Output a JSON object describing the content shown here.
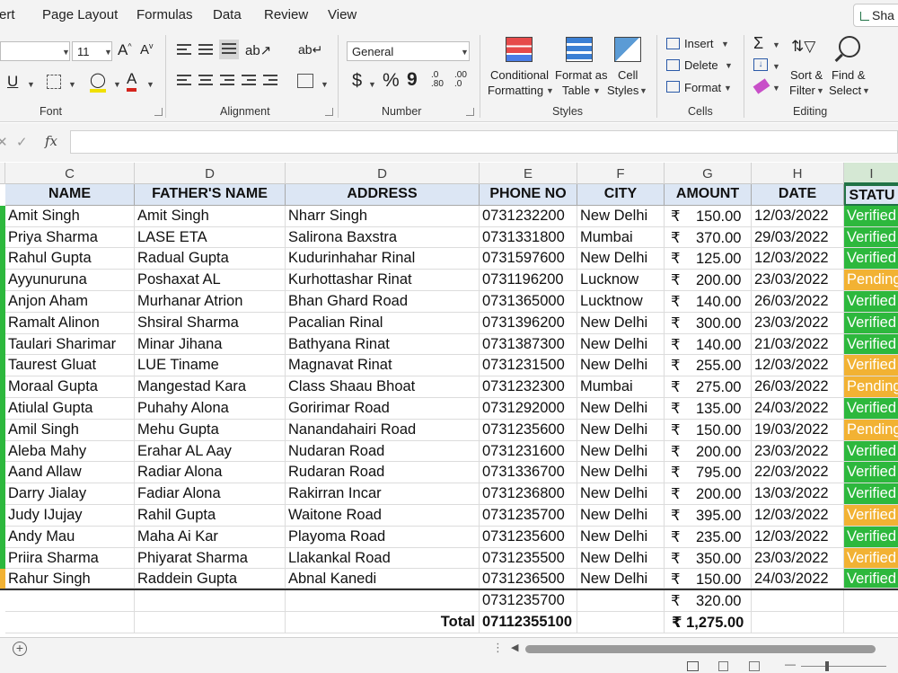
{
  "menu": [
    "ert",
    "Page Layout",
    "Formulas",
    "Data",
    "Review",
    "View"
  ],
  "share_label": "Sha",
  "ribbon": {
    "font_size": "11",
    "number_format": "General",
    "groups": {
      "font": "Font",
      "alignment": "Alignment",
      "number": "Number",
      "styles": "Styles",
      "cells": "Cells",
      "editing": "Editing"
    },
    "buttons": {
      "conditional_formatting_1": "Conditional",
      "conditional_formatting_2": "Formatting",
      "format_as_table_1": "Format as",
      "format_as_table_2": "Table",
      "cell_styles_1": "Cell",
      "cell_styles_2": "Styles",
      "insert": "Insert",
      "delete": "Delete",
      "format": "Format",
      "sort_filter_1": "Sort &",
      "sort_filter_2": "Filter",
      "find_select_1": "Find &",
      "find_select_2": "Select",
      "autosum": "Σ",
      "currency": "$",
      "percent": "%",
      "comma": "9",
      "inc_dec": ".0",
      "dec_dec": ".00",
      "underline": "U"
    }
  },
  "formula_bar": {
    "fx": "fx"
  },
  "columns": [
    {
      "letter": "C"
    },
    {
      "letter": "D"
    },
    {
      "letter": "D"
    },
    {
      "letter": "E"
    },
    {
      "letter": "F"
    },
    {
      "letter": "G"
    },
    {
      "letter": "H"
    },
    {
      "letter": "I"
    }
  ],
  "table": {
    "headers": [
      "NAME",
      "FATHER'S NAME",
      "ADDRESS",
      "PHONE NO",
      "CITY",
      "AMOUNT",
      "DATE",
      "STATU"
    ],
    "currency_symbol": "₹",
    "rows": [
      {
        "name": "Amit Singh",
        "father": "Amit Singh",
        "address": "Nharr Singh",
        "phone": "0731232200",
        "city": "New Delhi",
        "amount": "150.00",
        "date": "12/03/2022",
        "status": "Verified",
        "status_type": "verified"
      },
      {
        "name": "Priya Sharma",
        "father": "LASE ETA",
        "address": "Salirona Baxstra",
        "phone": "0731331800",
        "city": "Mumbai",
        "amount": "370.00",
        "date": "29/03/2022",
        "status": "Verified",
        "status_type": "verified"
      },
      {
        "name": "Rahul Gupta",
        "father": "Radual Gupta",
        "address": "Kudurinhahar Rinal",
        "phone": "0731597600",
        "city": "New Delhi",
        "amount": "125.00",
        "date": "12/03/2022",
        "status": "Verified",
        "status_type": "verified"
      },
      {
        "name": "Ayyunuruna",
        "father": "Poshaxat AL",
        "address": "Kurhottashar Rinat",
        "phone": "0731196200",
        "city": "Lucknow",
        "amount": "200.00",
        "date": "23/03/2022",
        "status": "Pending",
        "status_type": "pending"
      },
      {
        "name": "Anjon Aham",
        "father": "Murhanar Atrion",
        "address": "Bhan Ghard Road",
        "phone": "0731365000",
        "city": "Lucktnow",
        "amount": "140.00",
        "date": "26/03/2022",
        "status": "Verified",
        "status_type": "verified"
      },
      {
        "name": "Ramalt Alinon",
        "father": "Shsiral Sharma",
        "address": "Pacalian Rinal",
        "phone": "0731396200",
        "city": "New Delhi",
        "amount": "300.00",
        "date": "23/03/2022",
        "status": "Verified",
        "status_type": "verified"
      },
      {
        "name": "Taulari Sharimar",
        "father": "Minar Jihana",
        "address": "Bathyana Rinat",
        "phone": "0731387300",
        "city": "New Delhi",
        "amount": "140.00",
        "date": "21/03/2022",
        "status": "Verified",
        "status_type": "verified"
      },
      {
        "name": "Taurest Gluat",
        "father": "LUE Tiname",
        "address": "Magnavat Rinat",
        "phone": "0731231500",
        "city": "New Delhi",
        "amount": "255.00",
        "date": "12/03/2022",
        "status": "Verified",
        "status_type": "pending"
      },
      {
        "name": "Moraal Gupta",
        "father": "Mangestad Kara",
        "address": "Class Shaau Bhoat",
        "phone": "0731232300",
        "city": "Mumbai",
        "amount": "275.00",
        "date": "26/03/2022",
        "status": "Pending",
        "status_type": "pending"
      },
      {
        "name": "Atiulal Gupta",
        "father": "Puhahy Alona",
        "address": "Goririmar Road",
        "phone": "0731292000",
        "city": "New Delhi",
        "amount": "135.00",
        "date": "24/03/2022",
        "status": "Verified",
        "status_type": "verified"
      },
      {
        "name": "Amil Singh",
        "father": "Mehu Gupta",
        "address": "Nanandahairi Road",
        "phone": "0731235600",
        "city": "New Delhi",
        "amount": "150.00",
        "date": "19/03/2022",
        "status": "Pending",
        "status_type": "pending"
      },
      {
        "name": "Aleba Mahy",
        "father": "Erahar AL Aay",
        "address": "Nudaran Road",
        "phone": "0731231600",
        "city": "New Delhi",
        "amount": "200.00",
        "date": "23/03/2022",
        "status": "Verified",
        "status_type": "verified"
      },
      {
        "name": "Aand Allaw",
        "father": "Radiar Alona",
        "address": "Rudaran Road",
        "phone": "0731336700",
        "city": "New Delhi",
        "amount": "795.00",
        "date": "22/03/2022",
        "status": "Verified",
        "status_type": "verified"
      },
      {
        "name": "Darry Jialay",
        "father": "Fadiar Alona",
        "address": "Rakirran Incar",
        "phone": "0731236800",
        "city": "New Delhi",
        "amount": "200.00",
        "date": "13/03/2022",
        "status": "Verified",
        "status_type": "verified"
      },
      {
        "name": "Judy IJujay",
        "father": "Rahil Gupta",
        "address": "Waitone Road",
        "phone": "0731235700",
        "city": "New Delhi",
        "amount": "395.00",
        "date": "12/03/2022",
        "status": "Verified",
        "status_type": "pending"
      },
      {
        "name": "Andy Mau",
        "father": "Maha Ai Kar",
        "address": "Playoma Road",
        "phone": "0731235600",
        "city": "New Delhi",
        "amount": "235.00",
        "date": "12/03/2022",
        "status": "Verified",
        "status_type": "verified"
      },
      {
        "name": "Priira Sharma",
        "father": "Phiyarat Sharma",
        "address": "Llakankal Road",
        "phone": "0731235500",
        "city": "New Delhi",
        "amount": "350.00",
        "date": "23/03/2022",
        "status": "Verified",
        "status_type": "pending"
      },
      {
        "name": "Rahur Singh",
        "father": "Raddein Gupta",
        "address": "Abnal Kanedi",
        "phone": "0731236500",
        "city": "New Delhi",
        "amount": "150.00",
        "date": "24/03/2022",
        "status": "Verified",
        "status_type": "verified"
      }
    ],
    "extra_row": {
      "phone": "0731235700",
      "amount": "320.00"
    },
    "total_row": {
      "label": "Total",
      "phone": "07112355100",
      "amount": "1,275.00"
    }
  },
  "colors": {
    "verified": "#2db83d",
    "pending": "#f2b233",
    "header_fill": "#dce6f4",
    "accent": "#217346"
  }
}
